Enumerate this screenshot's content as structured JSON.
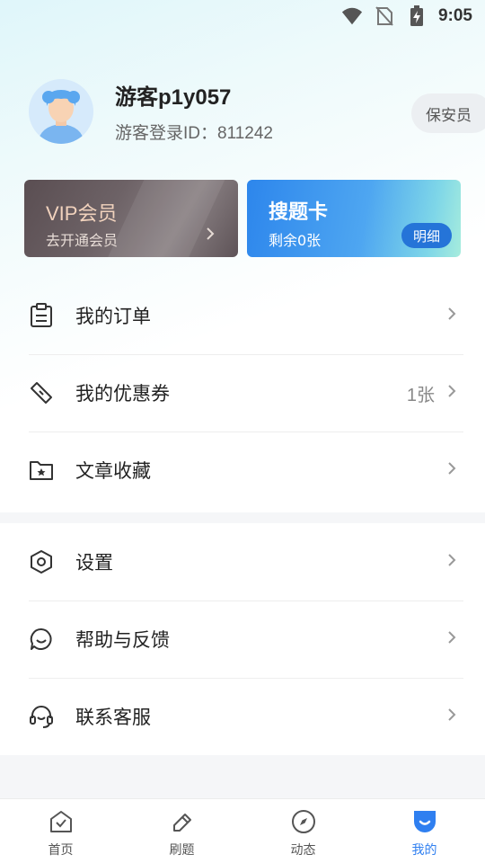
{
  "status_bar": {
    "time": "9:05"
  },
  "profile": {
    "username": "游客p1y057",
    "user_id": "游客登录ID：811242",
    "role_button": "保安员"
  },
  "cards": {
    "vip": {
      "title": "VIP会员",
      "subtitle": "去开通会员"
    },
    "search_card": {
      "title": "搜题卡",
      "subtitle": "剩余0张",
      "detail_button": "明细"
    }
  },
  "menu_group1": [
    {
      "label": "我的订单",
      "icon": "clipboard-icon",
      "count": ""
    },
    {
      "label": "我的优惠券",
      "icon": "ticket-icon",
      "count": "1张"
    },
    {
      "label": "文章收藏",
      "icon": "folder-star-icon",
      "count": ""
    }
  ],
  "menu_group2": [
    {
      "label": "设置",
      "icon": "hexagon-settings-icon"
    },
    {
      "label": "帮助与反馈",
      "icon": "chat-smile-icon"
    },
    {
      "label": "联系客服",
      "icon": "headset-icon"
    }
  ],
  "tabbar": [
    {
      "label": "首页",
      "icon": "home-check-icon",
      "active": false
    },
    {
      "label": "刷题",
      "icon": "pencil-icon",
      "active": false
    },
    {
      "label": "动态",
      "icon": "compass-icon",
      "active": false
    },
    {
      "label": "我的",
      "icon": "profile-icon",
      "active": true
    }
  ],
  "colors": {
    "accent": "#2f7ff0",
    "vip_text": "#f1d2bd",
    "card_blue": "#2d86ec"
  }
}
